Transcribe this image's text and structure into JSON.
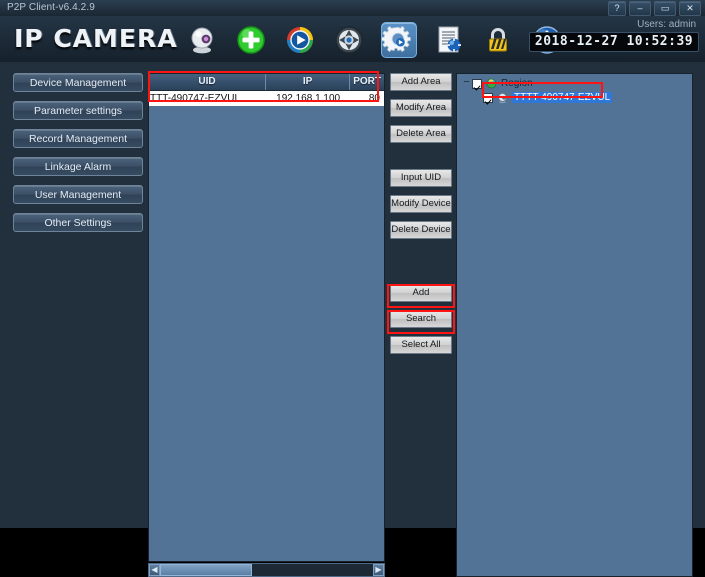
{
  "window": {
    "title": "P2P Client-v6.4.2.9",
    "controls": [
      {
        "name": "help-button",
        "label": "?"
      },
      {
        "name": "minimize-button",
        "label": "–"
      },
      {
        "name": "maximize-button",
        "label": "▭"
      },
      {
        "name": "close-button",
        "label": "✕"
      }
    ]
  },
  "header": {
    "brand": "IP CAMERA",
    "user_label": "Users: admin",
    "datetime": "2018-12-27 10:52:39",
    "icons": [
      {
        "name": "camera-icon",
        "selected": false
      },
      {
        "name": "add-plus-icon",
        "selected": false
      },
      {
        "name": "playback-icon",
        "selected": false
      },
      {
        "name": "ptz-control-icon",
        "selected": false
      },
      {
        "name": "settings-gear-icon",
        "selected": true
      },
      {
        "name": "log-document-icon",
        "selected": false
      },
      {
        "name": "lock-icon",
        "selected": false
      },
      {
        "name": "power-icon",
        "selected": false
      }
    ]
  },
  "sidebar": {
    "items": [
      {
        "label": "Device Management"
      },
      {
        "label": "Parameter settings"
      },
      {
        "label": "Record Management"
      },
      {
        "label": "Linkage Alarm"
      },
      {
        "label": "User Management"
      },
      {
        "label": "Other Settings"
      }
    ]
  },
  "device_list": {
    "columns": [
      "UID",
      "IP",
      "PORT"
    ],
    "rows": [
      {
        "uid": "TTT-490747-EZVUL",
        "ip": "192.168.1.100",
        "port": "80"
      }
    ],
    "scrollbar": {
      "left_arrow": "◀",
      "right_arrow": "▶"
    }
  },
  "action_buttons": [
    {
      "label": "Add Area",
      "name": "add-area-button",
      "highlighted": false
    },
    {
      "label": "Modify Area",
      "name": "modify-area-button",
      "highlighted": false
    },
    {
      "label": "Delete Area",
      "name": "delete-area-button",
      "highlighted": false
    },
    {
      "label": "Input UID",
      "name": "input-uid-button",
      "highlighted": false
    },
    {
      "label": "Modify Device",
      "name": "modify-device-button",
      "highlighted": false
    },
    {
      "label": "Delete Device",
      "name": "delete-device-button",
      "highlighted": false
    },
    {
      "label": "Add",
      "name": "add-button",
      "highlighted": true
    },
    {
      "label": "Search",
      "name": "search-button",
      "highlighted": true
    },
    {
      "label": "Select All",
      "name": "select-all-button",
      "highlighted": false
    }
  ],
  "tree": {
    "root": {
      "label": "Region",
      "expander": "−",
      "checked": true
    },
    "child": {
      "label": "TTTT-490747-EZVUL",
      "checked": true,
      "selected": true
    }
  },
  "annotations": {
    "highlight_color": "#ff1414",
    "boxes": [
      {
        "name": "device-list-highlight"
      },
      {
        "name": "add-button-highlight"
      },
      {
        "name": "search-button-highlight"
      },
      {
        "name": "tree-item-highlight"
      }
    ]
  }
}
